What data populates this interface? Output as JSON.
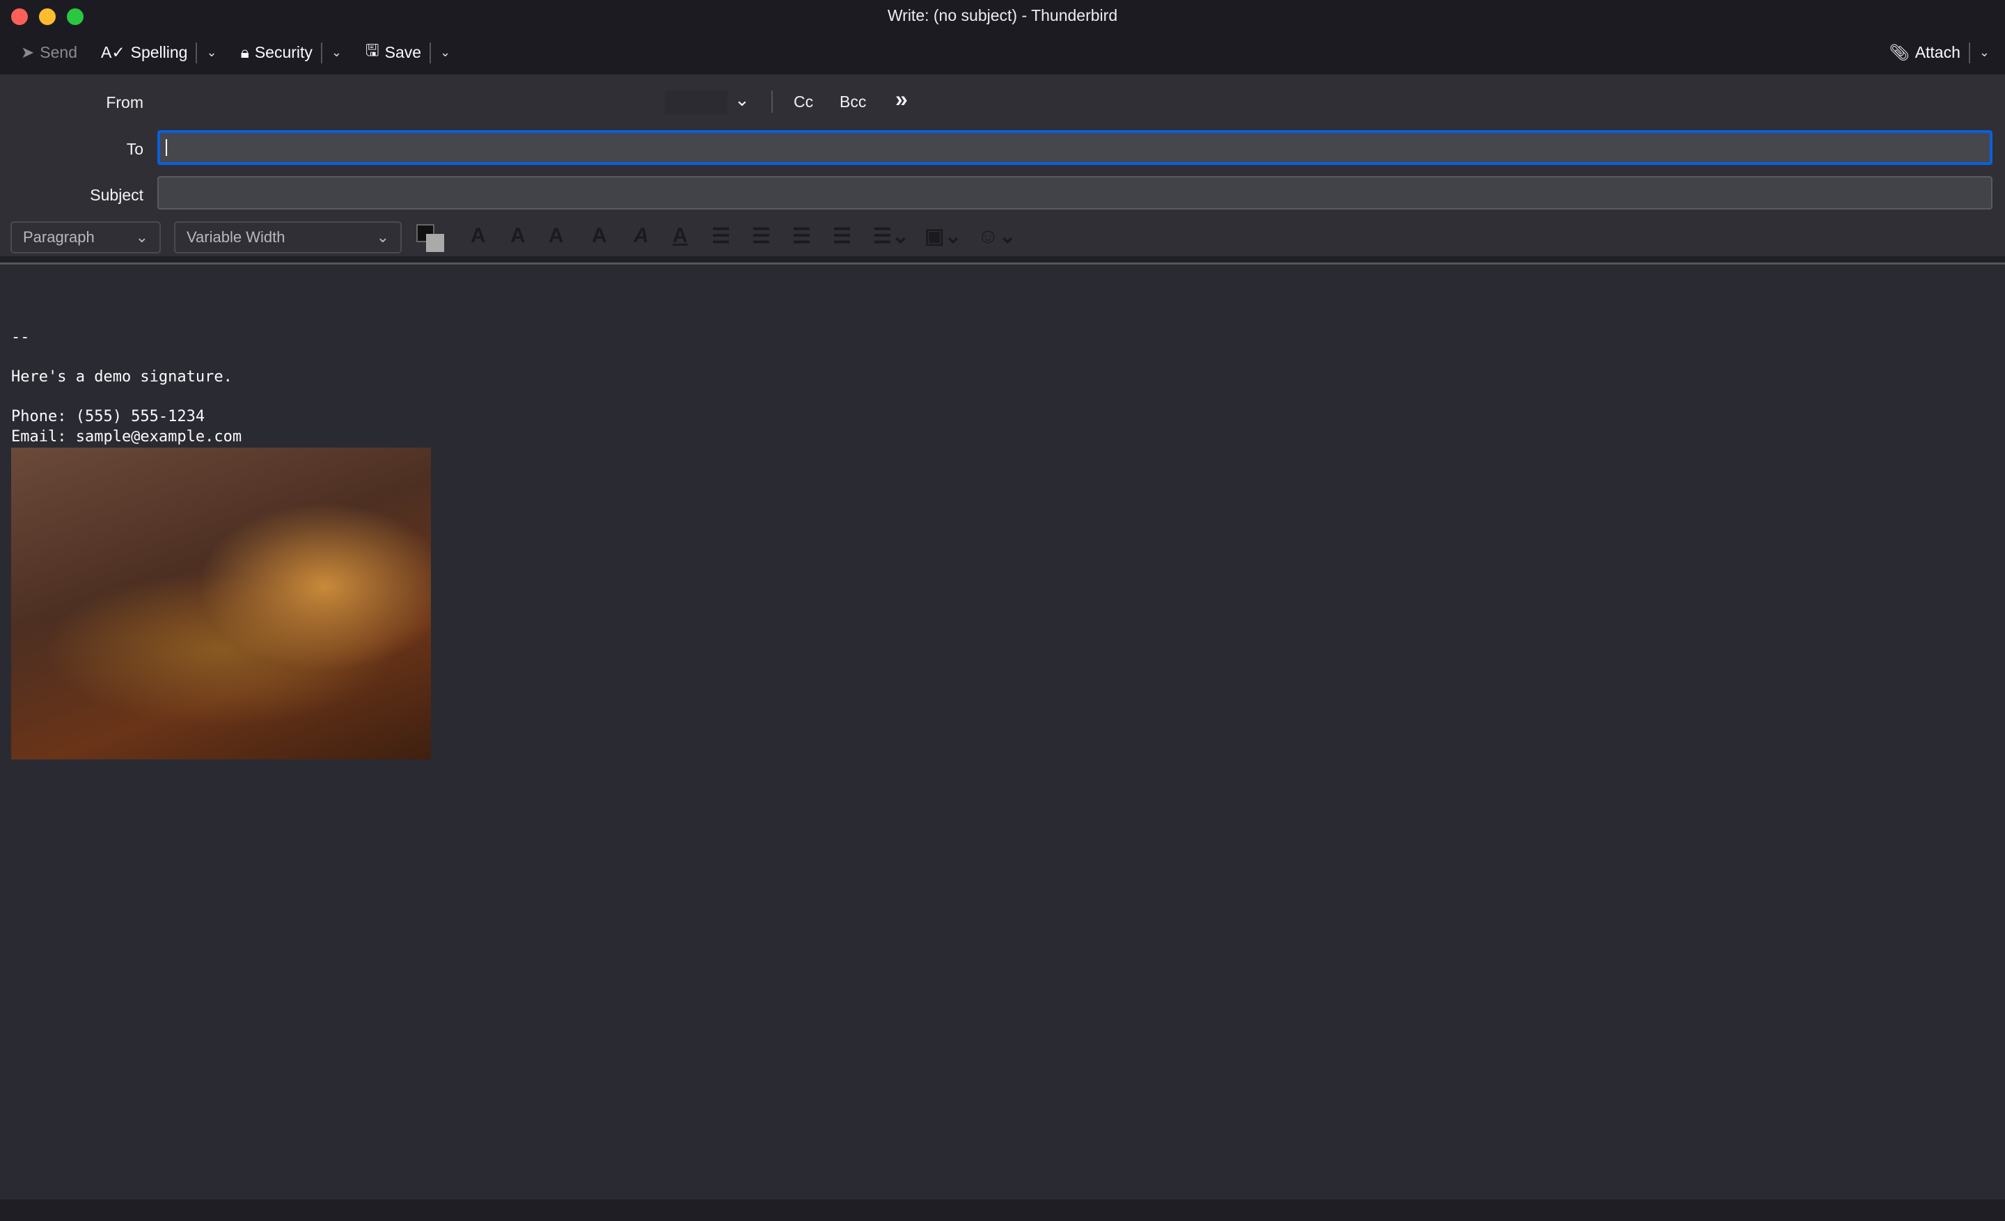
{
  "window": {
    "title": "Write: (no subject) - Thunderbird"
  },
  "toolbar": {
    "send": "Send",
    "spelling": "Spelling",
    "security": "Security",
    "save": "Save",
    "attach": "Attach"
  },
  "header": {
    "from_label": "From",
    "to_label": "To",
    "subject_label": "Subject",
    "cc": "Cc",
    "bcc": "Bcc",
    "to_value": "",
    "subject_value": ""
  },
  "format": {
    "paragraph": "Paragraph",
    "font": "Variable Width"
  },
  "body": {
    "lines": [
      "--",
      "",
      "Here's a demo signature.",
      "",
      "Phone: (555) 555-1234",
      "Email: sample@example.com"
    ]
  },
  "colors": {
    "focus": "#0a60dd",
    "background": "#2a2a33"
  }
}
